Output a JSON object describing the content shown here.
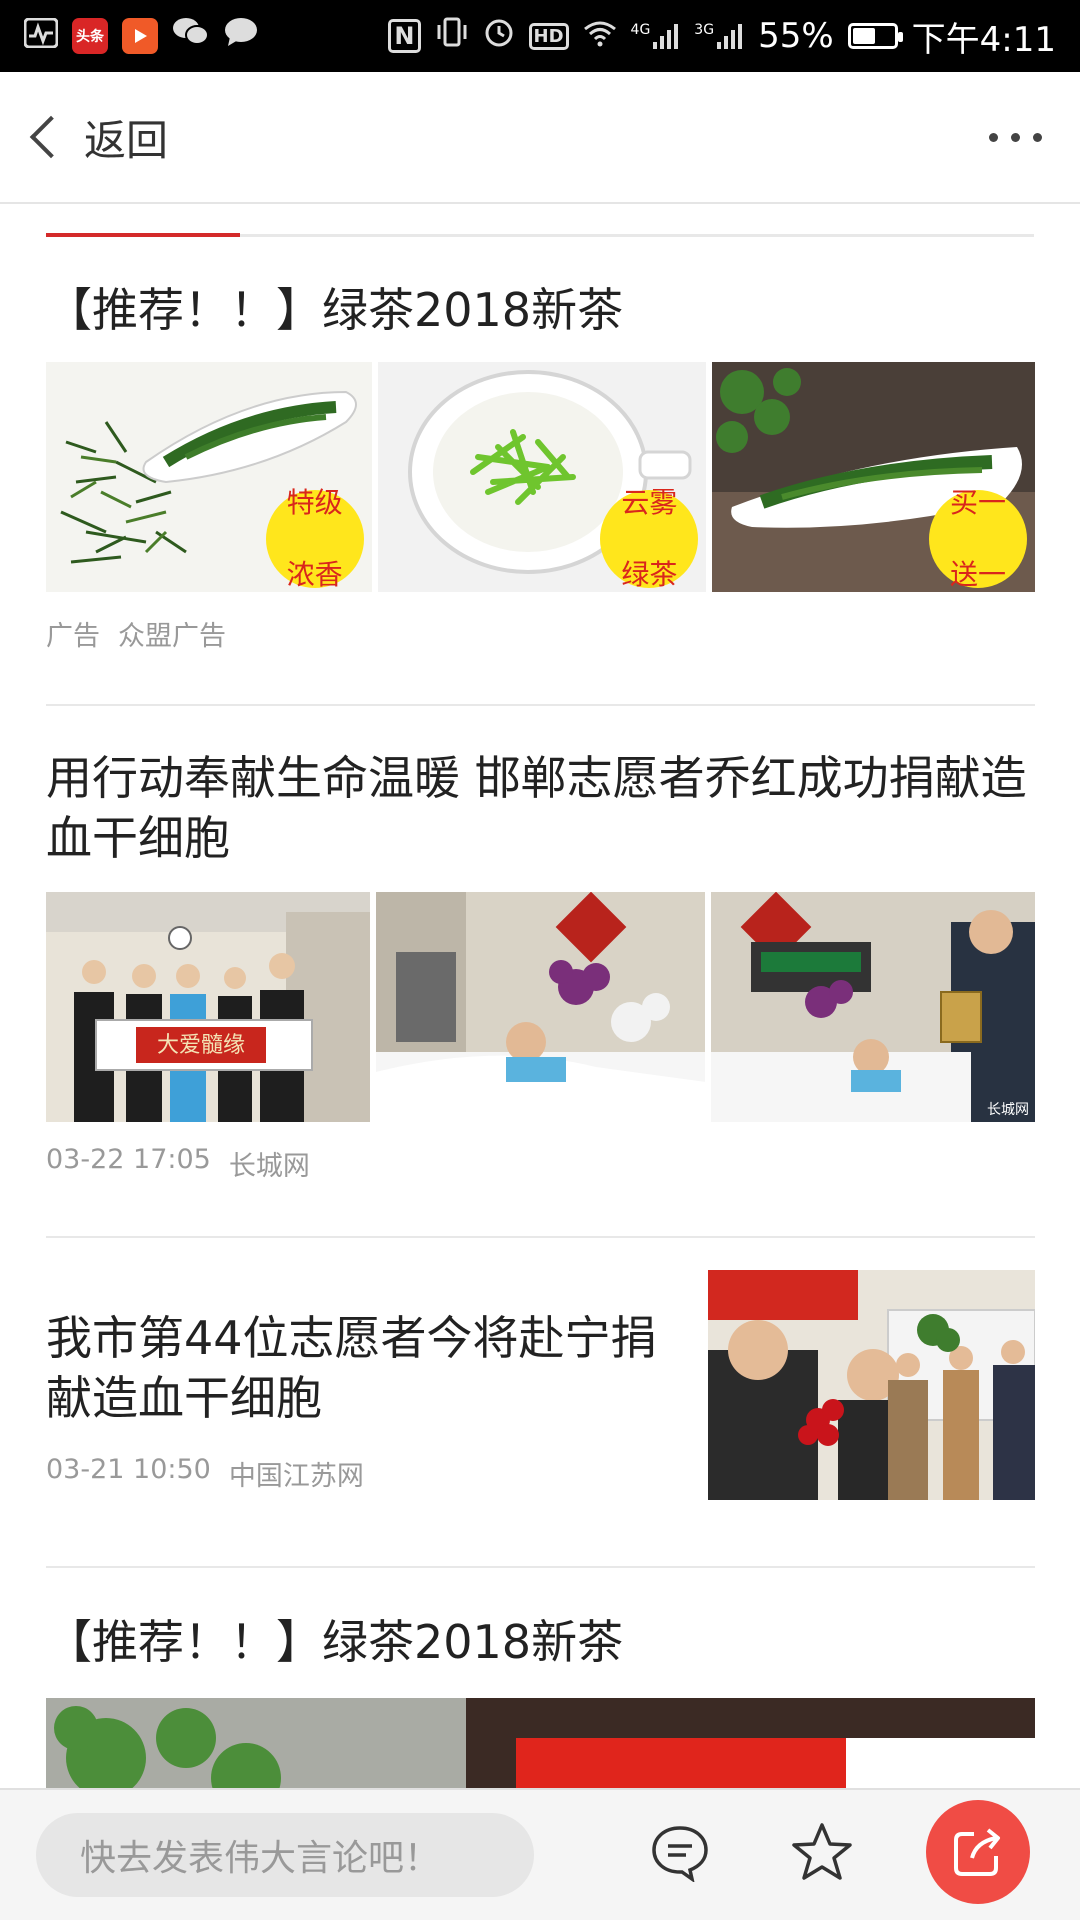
{
  "status_bar": {
    "app_badge_text": "头条",
    "nfc": "N",
    "hd": "HD",
    "net1": "4G",
    "net2": "3G",
    "battery": "55%",
    "battery_level": 0.55,
    "time": "下午4:11"
  },
  "nav": {
    "back_label": "返回"
  },
  "feed": [
    {
      "title": "【推荐！！】绿茶2018新茶",
      "badges": [
        "特级浓香",
        "云雾绿茶",
        "买一送一"
      ],
      "meta_left": "广告",
      "meta_right": "众盟广告"
    },
    {
      "title": "用行动奉献生命温暖 邯郸志愿者乔红成功捐献造血干细胞",
      "banner_text": "大爱髓缘",
      "watermark": "长城网",
      "meta_left": "03-22 17:05",
      "meta_right": "长城网"
    },
    {
      "title": "我市第44位志愿者今将赴宁捐献造血干细胞",
      "meta_left": "03-21 10:50",
      "meta_right": "中国江苏网"
    },
    {
      "title": "【推荐！！】绿茶2018新茶"
    }
  ],
  "bottom": {
    "comment_placeholder": "快去发表伟大言论吧！"
  },
  "colors": {
    "accent_red": "#d42a2a",
    "share_button": "#f04c45",
    "badge_yellow": "#ffe61c"
  }
}
